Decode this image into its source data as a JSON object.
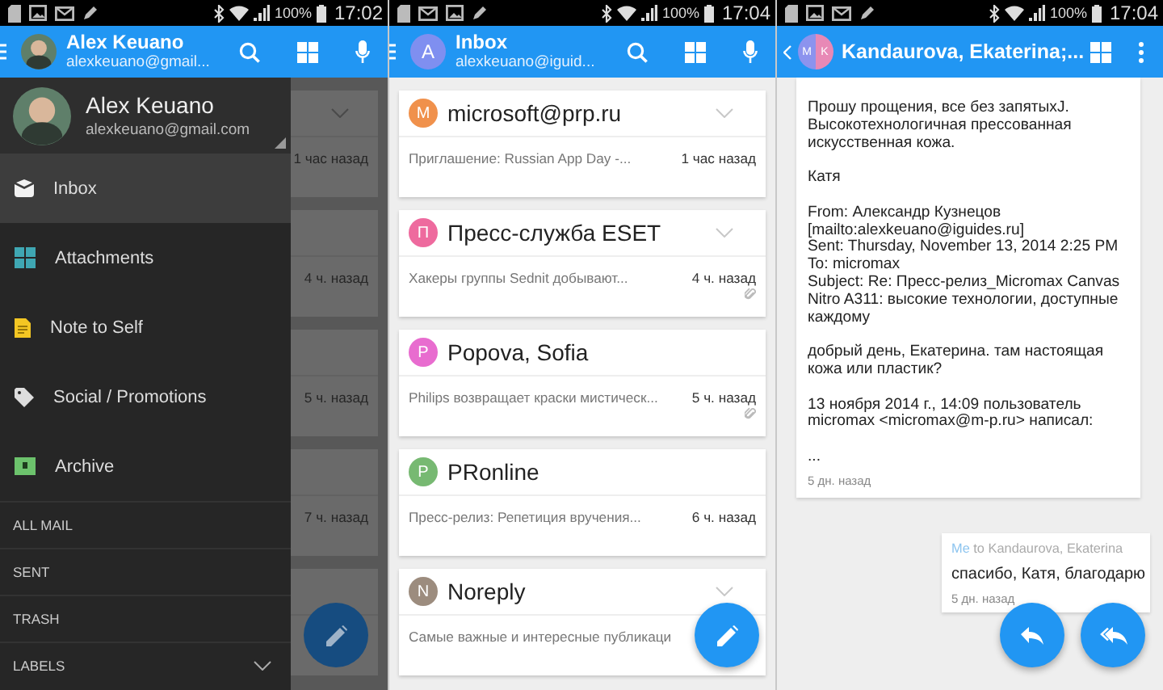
{
  "drawer_screen": {
    "status_bar": {
      "notifications": [
        {
          "kind": "sd"
        },
        {
          "kind": "picture"
        },
        {
          "kind": "mail"
        },
        {
          "kind": "pen"
        }
      ],
      "battery": "100%",
      "time": "17:02"
    },
    "app_bar": {
      "title": "Alex Keuano",
      "subtitle": "alexkeuano@gmail..."
    },
    "background_list": [
      {
        "time": "1 час назад",
        "collapsible": true
      },
      {
        "time": "4 ч. назад",
        "collapsible": false
      },
      {
        "time": "5 ч. назад",
        "collapsible": false
      },
      {
        "time": "7 ч. назад",
        "collapsible": false
      },
      {
        "collapsible": false
      }
    ],
    "drawer": {
      "account": {
        "name": "Alex Keuano",
        "email": "alexkeuano@gmail.com"
      },
      "items": [
        {
          "kind": "inbox",
          "label": "Inbox",
          "selected": true
        },
        {
          "kind": "attachments",
          "label": "Attachments",
          "selected": false
        },
        {
          "kind": "note",
          "label": "Note to Self",
          "selected": false
        },
        {
          "kind": "tag",
          "label": "Social / Promotions",
          "selected": false
        },
        {
          "kind": "archive",
          "label": "Archive",
          "selected": false
        }
      ],
      "sections": [
        {
          "label": "ALL MAIL",
          "expandable": false
        },
        {
          "label": "SENT",
          "expandable": false
        },
        {
          "label": "TRASH",
          "expandable": false
        },
        {
          "label": "LABELS",
          "expandable": true
        }
      ]
    }
  },
  "inbox_screen": {
    "status_bar": {
      "notifications": [
        {
          "kind": "sd"
        },
        {
          "kind": "mail"
        },
        {
          "kind": "picture"
        },
        {
          "kind": "pen"
        }
      ],
      "battery": "100%",
      "time": "17:04"
    },
    "app_bar": {
      "avatar_letter": "A",
      "title": "Inbox",
      "subtitle": "alexkeuano@iguid..."
    },
    "messages": [
      {
        "letter": "M",
        "color": "#f0914c",
        "sender": "microsoft@prp.ru",
        "snippet": "Приглашение: Russian App Day -...",
        "time": "1 час назад",
        "collapsible": true,
        "attachment": false
      },
      {
        "letter": "П",
        "color": "#ee6a9e",
        "sender": "Пресс-служба ESET",
        "snippet": "Хакеры группы Sednit добывают...",
        "time": "4 ч. назад",
        "collapsible": true,
        "attachment": true
      },
      {
        "letter": "P",
        "color": "#e86ccf",
        "sender": "Popova, Sofia",
        "snippet": "Philips возвращает краски мистическ...",
        "time": "5 ч. назад",
        "collapsible": false,
        "attachment": true
      },
      {
        "letter": "P",
        "color": "#77b972",
        "sender": "PRonline",
        "snippet": "Пресс-релиз: Репетиция вручения...",
        "time": "6 ч. назад",
        "collapsible": false,
        "attachment": false
      },
      {
        "letter": "N",
        "color": "#9c8c7e",
        "sender": "Noreply",
        "snippet": "Самые важные и интересные публикаци",
        "collapsible": true,
        "attachment": false
      }
    ]
  },
  "thread_screen": {
    "status_bar": {
      "notifications": [
        {
          "kind": "sd"
        },
        {
          "kind": "picture"
        },
        {
          "kind": "mail"
        },
        {
          "kind": "pen"
        }
      ],
      "battery": "100%",
      "time": "17:04"
    },
    "app_bar": {
      "avatar_letters": [
        "M",
        "K"
      ],
      "title": "Kandaurova, Ekaterina;..."
    },
    "message": {
      "paragraphs": [
        "Прошу прощения, все без запятыхJ.\nВысокотехнологичная прессованная\nискусственная кожа.",
        "Катя",
        "From: Александр Кузнецов\n[mailto:alexkeuano@iguides.ru]\nSent: Thursday, November 13, 2014 2:25 PM\nTo: micromax\nSubject: Re: Пресс-релиз_Micromax Canvas\nNitro A311: высокие технологии, доступные\nкаждому",
        "добрый день, Екатерина. там настоящая\nкожа или пластик?",
        "13 ноября 2014 г., 14:09 пользователь\nmicromax <micromax@m-p.ru> написал:",
        "..."
      ],
      "time": "5 дн. назад"
    },
    "reply": {
      "from": "Me",
      "recipients": "to Kandaurova, Ekaterina",
      "text": "спасибо, Катя, благодарю",
      "time": "5 дн. назад"
    }
  }
}
